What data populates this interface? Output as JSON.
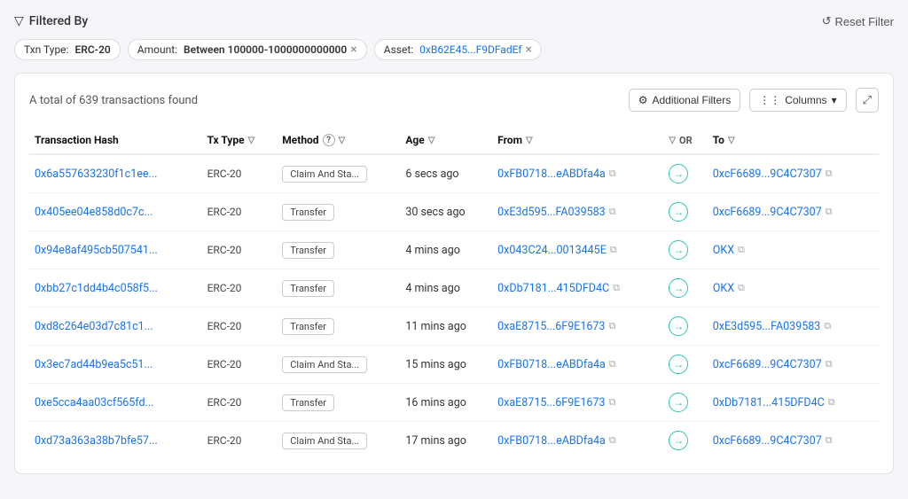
{
  "filterBar": {
    "title": "Filtered By",
    "resetLabel": "Reset Filter"
  },
  "chips": [
    {
      "id": "txn-type",
      "label": "Txn Type:",
      "value": "ERC-20",
      "removable": false
    },
    {
      "id": "amount",
      "label": "Amount:",
      "value": "Between 100000-1000000000000",
      "removable": true
    },
    {
      "id": "asset",
      "label": "Asset:",
      "value": "0xB62E45...F9DFadEf",
      "removable": true,
      "isLink": true
    }
  ],
  "card": {
    "summary": "A total of 639 transactions found",
    "additionalFilters": "Additional Filters",
    "columns": "Columns",
    "expandTitle": "Expand"
  },
  "table": {
    "headers": [
      {
        "id": "txhash",
        "label": "Transaction Hash"
      },
      {
        "id": "txtype",
        "label": "Tx Type",
        "sortable": true
      },
      {
        "id": "method",
        "label": "Method",
        "hasInfo": true,
        "filterable": true
      },
      {
        "id": "age",
        "label": "Age",
        "sortable": true
      },
      {
        "id": "from",
        "label": "From",
        "filterable": true
      },
      {
        "id": "or",
        "label": "OR"
      },
      {
        "id": "to",
        "label": "To",
        "filterable": true
      }
    ],
    "rows": [
      {
        "hash": "0x6a557633230f1c1ee...",
        "txType": "ERC-20",
        "method": "Claim And Sta...",
        "methodStyle": "badge",
        "age": "6 secs ago",
        "from": "0xFB0718...eABDfa4a",
        "to": "0xcF6689...9C4C7307",
        "toType": "address"
      },
      {
        "hash": "0x405ee04e858d0c7c...",
        "txType": "ERC-20",
        "method": "Transfer",
        "methodStyle": "badge",
        "age": "30 secs ago",
        "from": "0xE3d595...FA039583",
        "to": "0xcF6689...9C4C7307",
        "toType": "address"
      },
      {
        "hash": "0x94e8af495cb507541...",
        "txType": "ERC-20",
        "method": "Transfer",
        "methodStyle": "badge",
        "age": "4 mins ago",
        "from": "0x043C24...0013445E",
        "to": "OKX",
        "toType": "label"
      },
      {
        "hash": "0xbb27c1dd4b4c058f5...",
        "txType": "ERC-20",
        "method": "Transfer",
        "methodStyle": "badge",
        "age": "4 mins ago",
        "from": "0xDb7181...415DFD4C",
        "to": "OKX",
        "toType": "label"
      },
      {
        "hash": "0xd8c264e03d7c81c1...",
        "txType": "ERC-20",
        "method": "Transfer",
        "methodStyle": "badge",
        "age": "11 mins ago",
        "from": "0xaE8715...6F9E1673",
        "to": "0xE3d595...FA039583",
        "toType": "address"
      },
      {
        "hash": "0x3ec7ad44b9ea5c51...",
        "txType": "ERC-20",
        "method": "Claim And Sta...",
        "methodStyle": "badge",
        "age": "15 mins ago",
        "from": "0xFB0718...eABDfa4a",
        "to": "0xcF6689...9C4C7307",
        "toType": "address"
      },
      {
        "hash": "0xe5cca4aa03cf565fd...",
        "txType": "ERC-20",
        "method": "Transfer",
        "methodStyle": "badge",
        "age": "16 mins ago",
        "from": "0xaE8715...6F9E1673",
        "to": "0xDb7181...415DFD4C",
        "toType": "address"
      },
      {
        "hash": "0xd73a363a38b7bfe57...",
        "txType": "ERC-20",
        "method": "Claim And Sta...",
        "methodStyle": "badge",
        "age": "17 mins ago",
        "from": "0xFB0718...eABDfa4a",
        "to": "0xcF6689...9C4C7307",
        "toType": "address"
      }
    ]
  }
}
